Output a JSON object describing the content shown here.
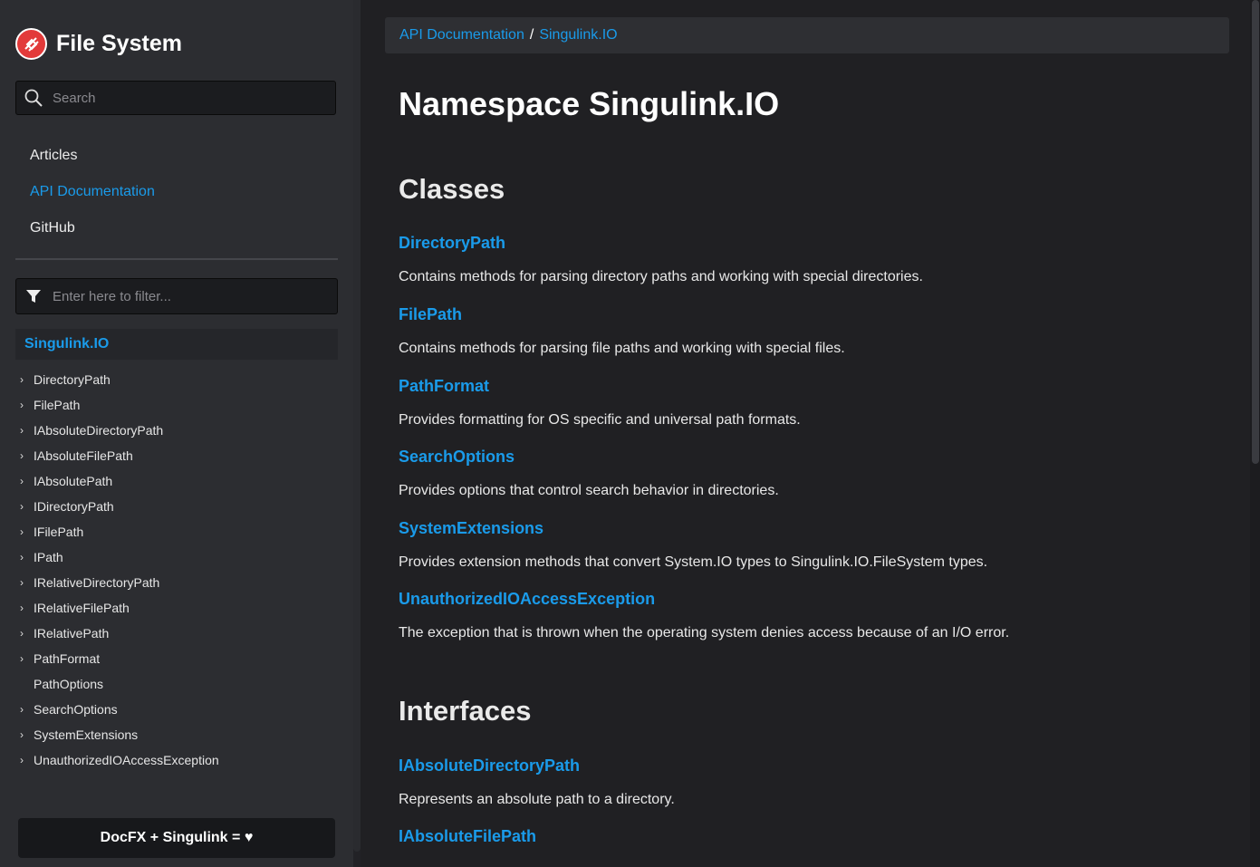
{
  "sidebar": {
    "brand_title": "File System",
    "search_placeholder": "Search",
    "nav": [
      {
        "label": "Articles",
        "active": false
      },
      {
        "label": "API Documentation",
        "active": true
      },
      {
        "label": "GitHub",
        "active": false
      }
    ],
    "filter_placeholder": "Enter here to filter...",
    "namespace": "Singulink.IO",
    "tree": [
      {
        "label": "DirectoryPath",
        "expandable": true
      },
      {
        "label": "FilePath",
        "expandable": true
      },
      {
        "label": "IAbsoluteDirectoryPath",
        "expandable": true
      },
      {
        "label": "IAbsoluteFilePath",
        "expandable": true
      },
      {
        "label": "IAbsolutePath",
        "expandable": true
      },
      {
        "label": "IDirectoryPath",
        "expandable": true
      },
      {
        "label": "IFilePath",
        "expandable": true
      },
      {
        "label": "IPath",
        "expandable": true
      },
      {
        "label": "IRelativeDirectoryPath",
        "expandable": true
      },
      {
        "label": "IRelativeFilePath",
        "expandable": true
      },
      {
        "label": "IRelativePath",
        "expandable": true
      },
      {
        "label": "PathFormat",
        "expandable": true
      },
      {
        "label": "PathOptions",
        "expandable": false
      },
      {
        "label": "SearchOptions",
        "expandable": true
      },
      {
        "label": "SystemExtensions",
        "expandable": true
      },
      {
        "label": "UnauthorizedIOAccessException",
        "expandable": true
      }
    ],
    "footer": "DocFX + Singulink = ♥"
  },
  "breadcrumb": [
    "API Documentation",
    "Singulink.IO"
  ],
  "breadcrumb_separator": "/",
  "main": {
    "title": "Namespace Singulink.IO",
    "classes_heading": "Classes",
    "classes": [
      {
        "name": "DirectoryPath",
        "desc": "Contains methods for parsing directory paths and working with special directories."
      },
      {
        "name": "FilePath",
        "desc": "Contains methods for parsing file paths and working with special files."
      },
      {
        "name": "PathFormat",
        "desc": "Provides formatting for OS specific and universal path formats."
      },
      {
        "name": "SearchOptions",
        "desc": "Provides options that control search behavior in directories."
      },
      {
        "name": "SystemExtensions",
        "desc": "Provides extension methods that convert System.IO types to Singulink.IO.FileSystem types."
      },
      {
        "name": "UnauthorizedIOAccessException",
        "desc": "The exception that is thrown when the operating system denies access because of an I/O error."
      }
    ],
    "interfaces_heading": "Interfaces",
    "interfaces": [
      {
        "name": "IAbsoluteDirectoryPath",
        "desc": "Represents an absolute path to a directory."
      },
      {
        "name": "IAbsoluteFilePath",
        "desc": ""
      }
    ]
  },
  "colors": {
    "accent": "#1a9bea",
    "background": "#202023",
    "sidebar": "#2c2d31",
    "brand_logo": "#e23a3a"
  }
}
